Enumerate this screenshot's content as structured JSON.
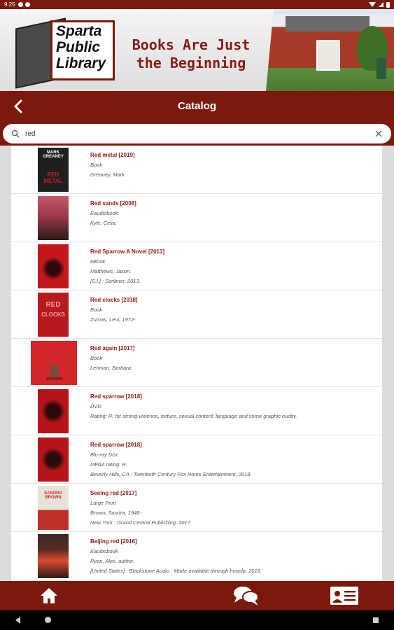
{
  "status_bar": {
    "time": "9:25"
  },
  "banner": {
    "logo_text": "Sparta Public Library",
    "tagline": "Books Are Just the Beginning"
  },
  "header": {
    "title": "Catalog",
    "back_icon": "chevron-left-icon"
  },
  "search": {
    "value": "red",
    "placeholder": ""
  },
  "colors": {
    "primary": "#7a1a0c",
    "title_text": "#8a1c12",
    "subtext": "#555555"
  },
  "results": [
    {
      "title": "Red metal [2019]",
      "lines": [
        "Book",
        "Greaney, Mark."
      ],
      "cover": {
        "bg": "#1f1f1f",
        "accent": "#c81e1e",
        "text": "MARK GREANEY",
        "sub": "RED METAL"
      }
    },
    {
      "title": "Red sands [2008]",
      "lines": [
        "Eaudiobook",
        "Kyle, Celia."
      ],
      "cover": {
        "bg": "#9e3a4a",
        "accent": "#2a1a1a",
        "text": "",
        "sub": ""
      }
    },
    {
      "title": "Red Sparrow A Novel [2013]",
      "lines": [
        "eBook",
        "Matthews, Jason.",
        "[S.l.] : Scribner, 2013."
      ],
      "cover": {
        "bg": "#c3171d",
        "accent": "#2a0a0a",
        "text": "",
        "sub": ""
      }
    },
    {
      "title": "Red clocks [2018]",
      "lines": [
        "Book",
        "Zumas, Leni, 1972-"
      ],
      "cover": {
        "bg": "#b8191e",
        "accent": "#f0a3a0",
        "text": "RED",
        "sub": "CLOCKS"
      }
    },
    {
      "title": "Red again [2017]",
      "lines": [
        "Book",
        "Lehman, Barbara."
      ],
      "cover": {
        "bg": "#d2262a",
        "accent": "#7a4a3a",
        "text": "",
        "sub": ""
      }
    },
    {
      "title": "Red sparrow [2018]",
      "lines": [
        "DVD",
        "Rating: R; for strong violence, torture, sexual content, language and some graphic nudity."
      ],
      "cover": {
        "bg": "#b5151a",
        "accent": "#2a0a0a",
        "text": "",
        "sub": ""
      }
    },
    {
      "title": "Red sparrow [2018]",
      "lines": [
        "Blu-ray Disc",
        "MPAA rating: R.",
        "Beverly Hills, CA : Twentieth Century Fox Home Entertainment, 2018."
      ],
      "cover": {
        "bg": "#b5151a",
        "accent": "#2a0a0a",
        "text": "",
        "sub": ""
      }
    },
    {
      "title": "Seeing red [2017]",
      "lines": [
        "Large Print",
        "Brown, Sandra, 1948-",
        "New York : Grand Central Publishing, 2017."
      ],
      "cover": {
        "bg": "#e8e3d8",
        "accent": "#c0302a",
        "text": "SANDRA BROWN",
        "sub": ""
      }
    },
    {
      "title": "Beijing red [2016]",
      "lines": [
        "Eaudiobook",
        "Ryan, Alex, author.",
        "[United States] : Blackstone Audio : Made available through hoopla, 2016."
      ],
      "cover": {
        "bg": "#5a2a22",
        "accent": "#d84a30",
        "text": "",
        "sub": ""
      }
    }
  ],
  "bottom_nav": [
    {
      "name": "home-icon",
      "label": "Home"
    },
    {
      "name": "chat-icon",
      "label": "Chat"
    },
    {
      "name": "library-card-icon",
      "label": "Library Card"
    }
  ]
}
